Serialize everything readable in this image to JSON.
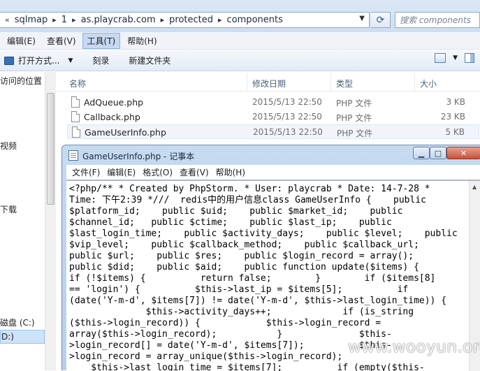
{
  "address_bar": {
    "crumbs": [
      "sqlmap",
      "1",
      "as.playcrab.com",
      "protected",
      "components"
    ],
    "search_placeholder": "搜索 components"
  },
  "menubar": {
    "items": [
      "编辑(E)",
      "查看(V)",
      "工具(T)",
      "帮助(H)"
    ],
    "active": "工具(T)"
  },
  "toolbar": {
    "open_label": "打开方式...",
    "burn_label": "刻录",
    "new_folder_label": "新建文件夹"
  },
  "nav_pane": {
    "items": [
      "访问的位置",
      "视频",
      "下载",
      "磁盘 (C:)",
      "D:)"
    ]
  },
  "file_list": {
    "columns": [
      "名称",
      "修改日期",
      "类型",
      "大小"
    ],
    "rows": [
      {
        "name": "AdQueue.php",
        "date": "2015/5/13 22:50",
        "type": "PHP 文件",
        "size": "3 KB"
      },
      {
        "name": "Callback.php",
        "date": "2015/5/13 22:50",
        "type": "PHP 文件",
        "size": "23 KB"
      },
      {
        "name": "GameUserInfo.php",
        "date": "2015/5/13 22:50",
        "type": "PHP 文件",
        "size": "5 KB"
      }
    ]
  },
  "notepad": {
    "title": "GameUserInfo.php - 记事本",
    "menus": [
      "文件(F)",
      "编辑(E)",
      "格式(O)",
      "查看(V)",
      "帮助(H)"
    ],
    "content": "<?php/** * Created by PhpStorm. * User: playcrab * Date: 14-7-28 *\nTime: 下午2:39 *///  redis中的用户信息class GameUserInfo {    public\n$platform_id;    public $uid;    public $market_id;    public\n$channel_id;   public $ctime;    public $last_ip;    public\n$last_login_time;    public $activity_days;    public $level;    public\n$vip_level;    public $callback_method;    public $callback_url;\npublic $url;    public $res;    public $login_record = array();\npublic $did;    public $aid;    public function update($items) {\nif (!$items) {          return false;        }        if ($items[8]\n== 'login') {          $this->last_ip = $items[5];          if\n(date('Y-m-d', $items[7]) != date('Y-m-d', $this->last_login_time)) {\n              $this->activity_days++;             if (is_string\n($this->login_record)) {            $this->login_record =\narray($this->login_record);           }              $this-\n>login_record[] = date('Y-m-d', $items[7]);          $this-\n>login_record = array_unique($this->login_record);\n    $this->last_login_time = $items[7];          if (empty($this-"
  },
  "watermark": "www.wooyun.org"
}
